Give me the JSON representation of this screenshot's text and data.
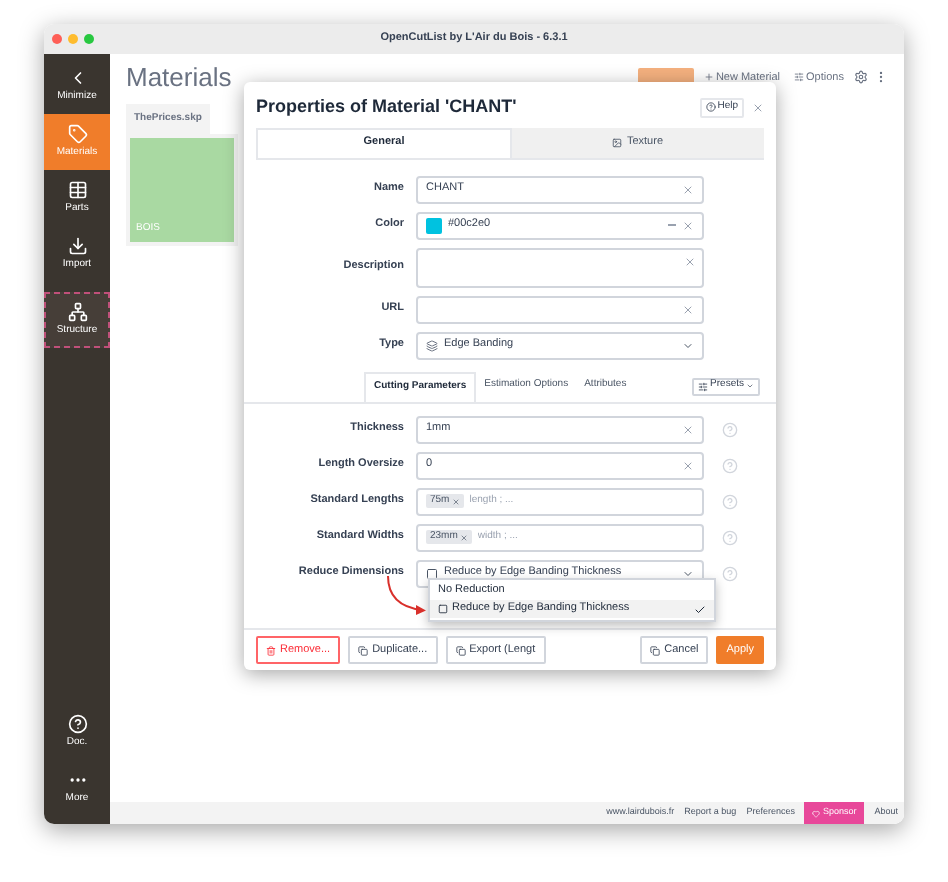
{
  "window": {
    "title": "OpenCutList by L'Air du Bois - 6.3.1"
  },
  "sidebar": {
    "items": [
      {
        "kind": "minimize",
        "label": "Minimize",
        "selected": false,
        "focused": false
      },
      {
        "kind": "materials",
        "label": "Materials",
        "selected": true,
        "focused": false
      },
      {
        "kind": "parts",
        "label": "Parts",
        "selected": false,
        "focused": false
      },
      {
        "kind": "import",
        "label": "Import",
        "selected": false,
        "focused": false
      },
      {
        "kind": "structure",
        "label": "Structure",
        "selected": false,
        "focused": true
      }
    ],
    "bottom_items": [
      {
        "kind": "doc",
        "label": "Doc."
      },
      {
        "kind": "more",
        "label": "More"
      }
    ]
  },
  "content": {
    "title": "Materials",
    "toolbar": [
      "New Material",
      "Options"
    ],
    "file_tab": "ThePrices.skp",
    "materials": [
      {
        "name": "BOIS",
        "color": "#a9d9a2"
      }
    ]
  },
  "dialog": {
    "title": "Properties of Material 'CHANT'",
    "help": "Help",
    "tabs": [
      {
        "label": "General",
        "selected": true
      },
      {
        "label": "Texture",
        "selected": false
      }
    ],
    "fields": [
      {
        "kind": "text",
        "label": "Name",
        "value": "CHANT"
      },
      {
        "kind": "color",
        "label": "Color",
        "value": "#00c2e0",
        "color": "#00c2e0"
      },
      {
        "kind": "textarea",
        "label": "Description"
      },
      {
        "kind": "text",
        "label": "URL"
      },
      {
        "kind": "select",
        "label": "Type",
        "value": "Edge Banding"
      }
    ],
    "subtabs": [
      {
        "label": "Cutting Parameters",
        "selected": true
      },
      {
        "label": "Estimation Options",
        "selected": false
      },
      {
        "label": "Attributes",
        "selected": false
      }
    ],
    "presets": "Presets",
    "parameters": [
      {
        "kind": "text",
        "label": "Thickness",
        "value": "1mm"
      },
      {
        "kind": "text",
        "label": "Length Oversize",
        "value": "0"
      },
      {
        "kind": "tags",
        "label": "Standard Lengths",
        "tags": [
          "75m"
        ],
        "placeholder": "length ; ..."
      },
      {
        "kind": "tags",
        "label": "Standard Widths",
        "tags": [
          "23mm"
        ],
        "placeholder": "width ; ..."
      },
      {
        "kind": "select",
        "label": "Reduce Dimensions",
        "value": "Reduce by Edge Banding Thickness"
      }
    ],
    "dropdown": [
      {
        "label": "No Reduction",
        "selected": false
      },
      {
        "label": "Reduce by Edge Banding Thickness",
        "selected": true
      }
    ],
    "buttons": [
      {
        "kind": "danger",
        "label": "Remove..."
      },
      {
        "kind": "default",
        "label": "Duplicate..."
      },
      {
        "kind": "default",
        "label": "Export (Lengt"
      },
      {
        "kind": "spacer"
      },
      {
        "kind": "default",
        "label": "Cancel"
      },
      {
        "kind": "primary",
        "label": "Apply"
      }
    ]
  },
  "footer": {
    "links": [
      {
        "kind": "link",
        "label": "www.lairdubois.fr"
      },
      {
        "kind": "link",
        "label": "Report a bug"
      },
      {
        "kind": "link",
        "label": "Preferences"
      },
      {
        "kind": "sponsor",
        "label": "Sponsor"
      },
      {
        "kind": "link",
        "label": "About"
      }
    ]
  }
}
